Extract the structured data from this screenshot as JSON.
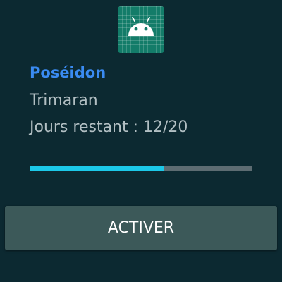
{
  "app_icon": {
    "icon": "android-icon",
    "color": "#137c69"
  },
  "item": {
    "title": "Poséidon",
    "subtitle": "Trimaran",
    "days_label": "Jours restant : 12/20"
  },
  "progress": {
    "current": 12,
    "total": 20,
    "fraction": 0.6
  },
  "actions": {
    "activate_label": "ACTIVER"
  },
  "colors": {
    "background": "#0c2931",
    "title": "#3a8bf2",
    "text": "#b2bfc3",
    "progress_fill": "#1cc8e8",
    "progress_track": "#5d6c72",
    "button": "#3c5959"
  }
}
